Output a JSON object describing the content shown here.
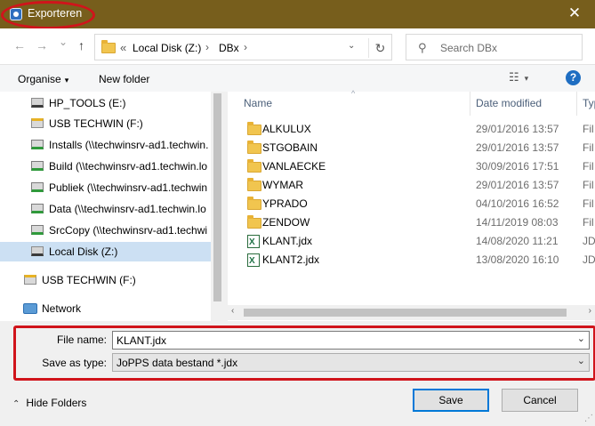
{
  "window": {
    "title": "Exporteren",
    "close_glyph": "✕",
    "icon": "app-icon"
  },
  "address": {
    "back_glyph": "←",
    "forward_glyph": "→",
    "recent_glyph": "⌄",
    "up_glyph": "↑",
    "overflow_glyph": "«",
    "segments": [
      "Local Disk (Z:)",
      "DBx"
    ],
    "separator": "›",
    "dropdown_glyph": "⌄",
    "refresh_glyph": "↻"
  },
  "search": {
    "placeholder": "Search DBx",
    "icon_glyph": "⚲"
  },
  "toolbar": {
    "organise_label": "Organise",
    "organise_caret": "▾",
    "new_folder_label": "New folder",
    "views_glyph": "☷",
    "views_caret": "▾",
    "help_glyph": "?"
  },
  "nav_items": [
    {
      "label": "HP_TOOLS (E:)",
      "icon": "drive-icon"
    },
    {
      "label": "USB TECHWIN (F:)",
      "icon": "usb-drive-icon"
    },
    {
      "label": "Installs (\\\\techwinsrv-ad1.techwin.",
      "icon": "network-drive-icon"
    },
    {
      "label": "Build (\\\\techwinsrv-ad1.techwin.lo",
      "icon": "network-drive-icon"
    },
    {
      "label": "Publiek (\\\\techwinsrv-ad1.techwin",
      "icon": "network-drive-icon"
    },
    {
      "label": "Data (\\\\techwinsrv-ad1.techwin.lo",
      "icon": "network-drive-icon"
    },
    {
      "label": "SrcCopy (\\\\techwinsrv-ad1.techwi",
      "icon": "network-drive-icon"
    },
    {
      "label": "Local Disk (Z:)",
      "icon": "drive-icon",
      "selected": true
    },
    {
      "label": "USB TECHWIN (F:)",
      "icon": "usb-drive-icon"
    },
    {
      "label": "Network",
      "icon": "network-icon"
    }
  ],
  "columns": {
    "name": "Name",
    "date": "Date modified",
    "type": "Typ",
    "sort_glyph": "^"
  },
  "files": [
    {
      "name": "ALKULUX",
      "date": "29/01/2016 13:57",
      "type": "Fil",
      "kind": "folder"
    },
    {
      "name": "STGOBAIN",
      "date": "29/01/2016 13:57",
      "type": "Fil",
      "kind": "folder"
    },
    {
      "name": "VANLAECKE",
      "date": "30/09/2016 17:51",
      "type": "Fil",
      "kind": "folder"
    },
    {
      "name": "WYMAR",
      "date": "29/01/2016 13:57",
      "type": "Fil",
      "kind": "folder"
    },
    {
      "name": "YPRADO",
      "date": "04/10/2016 16:52",
      "type": "Fil",
      "kind": "folder"
    },
    {
      "name": "ZENDOW",
      "date": "14/11/2019 08:03",
      "type": "Fil",
      "kind": "folder"
    },
    {
      "name": "KLANT.jdx",
      "date": "14/08/2020 11:21",
      "type": "JD",
      "kind": "file"
    },
    {
      "name": "KLANT2.jdx",
      "date": "13/08/2020 16:10",
      "type": "JD",
      "kind": "file"
    }
  ],
  "scroll": {
    "left_glyph": "‹",
    "right_glyph": "›"
  },
  "form": {
    "filename_label": "File name:",
    "filename_value": "KLANT.jdx",
    "savetype_label": "Save as type:",
    "savetype_value": "JoPPS data bestand *.jdx",
    "chevron_glyph": "⌄"
  },
  "footer": {
    "hide_folders_label": "Hide Folders",
    "hide_folders_glyph": "⌃",
    "save_label": "Save",
    "cancel_label": "Cancel",
    "grip_glyph": "⋰"
  },
  "colors": {
    "titlebar": "#775e1c",
    "highlight": "#d0141b",
    "selection": "#cce0f3",
    "accent": "#0078d7"
  }
}
